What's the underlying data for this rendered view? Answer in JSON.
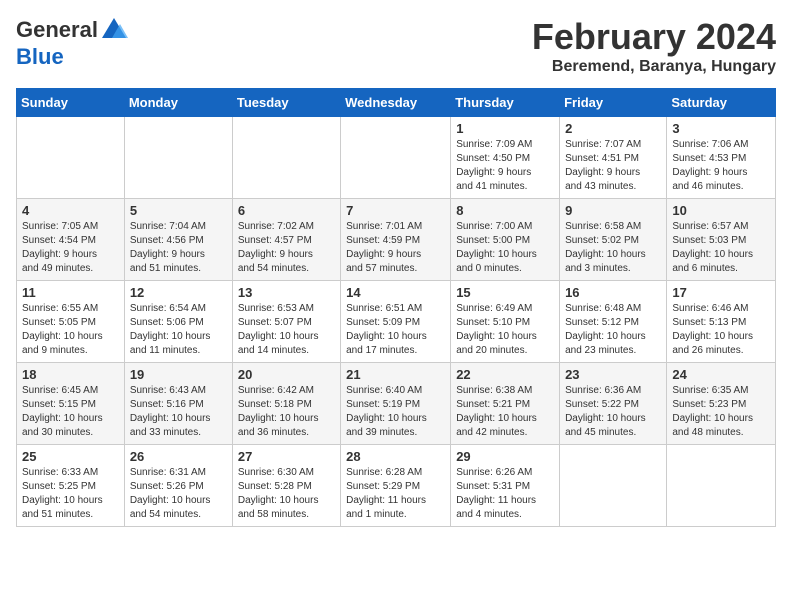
{
  "header": {
    "logo_line1": "General",
    "logo_line2": "Blue",
    "title": "February 2024",
    "subtitle": "Beremend, Baranya, Hungary"
  },
  "weekdays": [
    "Sunday",
    "Monday",
    "Tuesday",
    "Wednesday",
    "Thursday",
    "Friday",
    "Saturday"
  ],
  "weeks": [
    [
      {
        "day": "",
        "info": ""
      },
      {
        "day": "",
        "info": ""
      },
      {
        "day": "",
        "info": ""
      },
      {
        "day": "",
        "info": ""
      },
      {
        "day": "1",
        "info": "Sunrise: 7:09 AM\nSunset: 4:50 PM\nDaylight: 9 hours\nand 41 minutes."
      },
      {
        "day": "2",
        "info": "Sunrise: 7:07 AM\nSunset: 4:51 PM\nDaylight: 9 hours\nand 43 minutes."
      },
      {
        "day": "3",
        "info": "Sunrise: 7:06 AM\nSunset: 4:53 PM\nDaylight: 9 hours\nand 46 minutes."
      }
    ],
    [
      {
        "day": "4",
        "info": "Sunrise: 7:05 AM\nSunset: 4:54 PM\nDaylight: 9 hours\nand 49 minutes."
      },
      {
        "day": "5",
        "info": "Sunrise: 7:04 AM\nSunset: 4:56 PM\nDaylight: 9 hours\nand 51 minutes."
      },
      {
        "day": "6",
        "info": "Sunrise: 7:02 AM\nSunset: 4:57 PM\nDaylight: 9 hours\nand 54 minutes."
      },
      {
        "day": "7",
        "info": "Sunrise: 7:01 AM\nSunset: 4:59 PM\nDaylight: 9 hours\nand 57 minutes."
      },
      {
        "day": "8",
        "info": "Sunrise: 7:00 AM\nSunset: 5:00 PM\nDaylight: 10 hours\nand 0 minutes."
      },
      {
        "day": "9",
        "info": "Sunrise: 6:58 AM\nSunset: 5:02 PM\nDaylight: 10 hours\nand 3 minutes."
      },
      {
        "day": "10",
        "info": "Sunrise: 6:57 AM\nSunset: 5:03 PM\nDaylight: 10 hours\nand 6 minutes."
      }
    ],
    [
      {
        "day": "11",
        "info": "Sunrise: 6:55 AM\nSunset: 5:05 PM\nDaylight: 10 hours\nand 9 minutes."
      },
      {
        "day": "12",
        "info": "Sunrise: 6:54 AM\nSunset: 5:06 PM\nDaylight: 10 hours\nand 11 minutes."
      },
      {
        "day": "13",
        "info": "Sunrise: 6:53 AM\nSunset: 5:07 PM\nDaylight: 10 hours\nand 14 minutes."
      },
      {
        "day": "14",
        "info": "Sunrise: 6:51 AM\nSunset: 5:09 PM\nDaylight: 10 hours\nand 17 minutes."
      },
      {
        "day": "15",
        "info": "Sunrise: 6:49 AM\nSunset: 5:10 PM\nDaylight: 10 hours\nand 20 minutes."
      },
      {
        "day": "16",
        "info": "Sunrise: 6:48 AM\nSunset: 5:12 PM\nDaylight: 10 hours\nand 23 minutes."
      },
      {
        "day": "17",
        "info": "Sunrise: 6:46 AM\nSunset: 5:13 PM\nDaylight: 10 hours\nand 26 minutes."
      }
    ],
    [
      {
        "day": "18",
        "info": "Sunrise: 6:45 AM\nSunset: 5:15 PM\nDaylight: 10 hours\nand 30 minutes."
      },
      {
        "day": "19",
        "info": "Sunrise: 6:43 AM\nSunset: 5:16 PM\nDaylight: 10 hours\nand 33 minutes."
      },
      {
        "day": "20",
        "info": "Sunrise: 6:42 AM\nSunset: 5:18 PM\nDaylight: 10 hours\nand 36 minutes."
      },
      {
        "day": "21",
        "info": "Sunrise: 6:40 AM\nSunset: 5:19 PM\nDaylight: 10 hours\nand 39 minutes."
      },
      {
        "day": "22",
        "info": "Sunrise: 6:38 AM\nSunset: 5:21 PM\nDaylight: 10 hours\nand 42 minutes."
      },
      {
        "day": "23",
        "info": "Sunrise: 6:36 AM\nSunset: 5:22 PM\nDaylight: 10 hours\nand 45 minutes."
      },
      {
        "day": "24",
        "info": "Sunrise: 6:35 AM\nSunset: 5:23 PM\nDaylight: 10 hours\nand 48 minutes."
      }
    ],
    [
      {
        "day": "25",
        "info": "Sunrise: 6:33 AM\nSunset: 5:25 PM\nDaylight: 10 hours\nand 51 minutes."
      },
      {
        "day": "26",
        "info": "Sunrise: 6:31 AM\nSunset: 5:26 PM\nDaylight: 10 hours\nand 54 minutes."
      },
      {
        "day": "27",
        "info": "Sunrise: 6:30 AM\nSunset: 5:28 PM\nDaylight: 10 hours\nand 58 minutes."
      },
      {
        "day": "28",
        "info": "Sunrise: 6:28 AM\nSunset: 5:29 PM\nDaylight: 11 hours\nand 1 minute."
      },
      {
        "day": "29",
        "info": "Sunrise: 6:26 AM\nSunset: 5:31 PM\nDaylight: 11 hours\nand 4 minutes."
      },
      {
        "day": "",
        "info": ""
      },
      {
        "day": "",
        "info": ""
      }
    ]
  ]
}
